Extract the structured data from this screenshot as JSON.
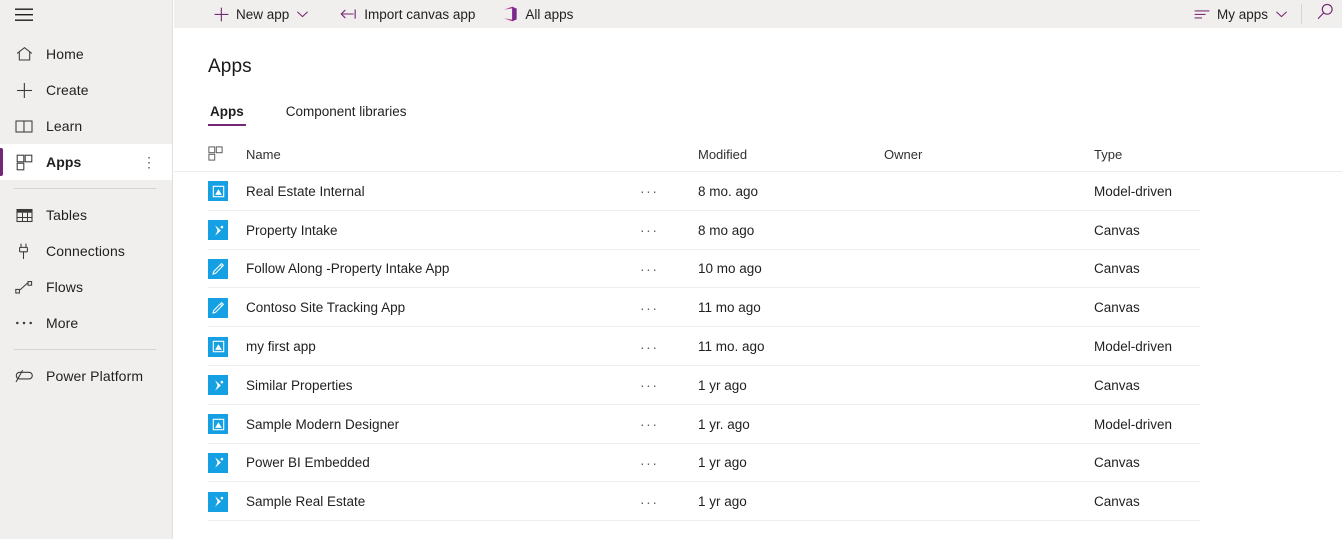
{
  "sidebar": {
    "hamburger_icon": "hamburger-menu-icon",
    "items": [
      {
        "label": "Home",
        "icon": "home-icon",
        "selected": false
      },
      {
        "label": "Create",
        "icon": "plus-icon",
        "selected": false
      },
      {
        "label": "Learn",
        "icon": "book-icon",
        "selected": false
      },
      {
        "label": "Apps",
        "icon": "apps-grid-icon",
        "selected": true,
        "overflow": "⋮"
      },
      {
        "label": "Tables",
        "icon": "table-icon",
        "selected": false
      },
      {
        "label": "Connections",
        "icon": "plug-icon",
        "selected": false
      },
      {
        "label": "Flows",
        "icon": "flow-icon",
        "selected": false
      },
      {
        "label": "More",
        "icon": "ellipsis-icon",
        "selected": false
      },
      {
        "label": "Power Platform",
        "icon": "power-platform-icon",
        "selected": false
      }
    ]
  },
  "commandbar": {
    "new_app": {
      "label": "New app",
      "icon": "plus-icon",
      "chevron": "chevron-down-icon"
    },
    "import_canvas_app": {
      "label": "Import canvas app",
      "icon": "import-arrow-icon"
    },
    "all_apps": {
      "label": "All apps",
      "icon": "office-apps-icon"
    },
    "my_apps": {
      "label": "My apps",
      "icon": "filter-lines-icon",
      "chevron": "chevron-down-icon"
    },
    "search": {
      "icon": "search-icon"
    }
  },
  "main": {
    "page_title": "Apps",
    "tabs": [
      {
        "label": "Apps",
        "active": true
      },
      {
        "label": "Component libraries",
        "active": false
      }
    ],
    "table": {
      "columns": {
        "icon": "apps-grid-icon",
        "name": "Name",
        "modified": "Modified",
        "owner": "Owner",
        "type": "Type"
      },
      "row_overflow_label": "···",
      "rows": [
        {
          "name": "Real Estate Internal",
          "icon": "model-driven-app-icon",
          "modified": "8 mo. ago",
          "owner": "",
          "type": "Model-driven"
        },
        {
          "name": "Property Intake",
          "icon": "canvas-app-icon",
          "modified": "8 mo ago",
          "owner": "",
          "type": "Canvas"
        },
        {
          "name": "Follow Along -Property Intake App",
          "icon": "pencil-app-icon",
          "modified": "10 mo ago",
          "owner": "",
          "type": "Canvas"
        },
        {
          "name": "Contoso Site Tracking App",
          "icon": "pencil-app-icon",
          "modified": "11 mo ago",
          "owner": "",
          "type": "Canvas"
        },
        {
          "name": "my first app",
          "icon": "model-driven-app-icon",
          "modified": "11 mo. ago",
          "owner": "",
          "type": "Model-driven"
        },
        {
          "name": "Similar Properties",
          "icon": "canvas-app-icon",
          "modified": "1 yr ago",
          "owner": "",
          "type": "Canvas"
        },
        {
          "name": "Sample Modern Designer",
          "icon": "model-driven-app-icon",
          "modified": "1 yr. ago",
          "owner": "",
          "type": "Model-driven"
        },
        {
          "name": "Power BI Embedded",
          "icon": "canvas-app-icon",
          "modified": "1 yr ago",
          "owner": "",
          "type": "Canvas"
        },
        {
          "name": "Sample Real Estate",
          "icon": "canvas-app-icon",
          "modified": "1 yr ago",
          "owner": "",
          "type": "Canvas"
        }
      ]
    }
  },
  "colors": {
    "accent_purple": "#742774",
    "app_icon_blue": "#14a0e3",
    "sidebar_bg": "#f0efee",
    "text_primary": "#201f1e",
    "divider": "#edebe9"
  }
}
